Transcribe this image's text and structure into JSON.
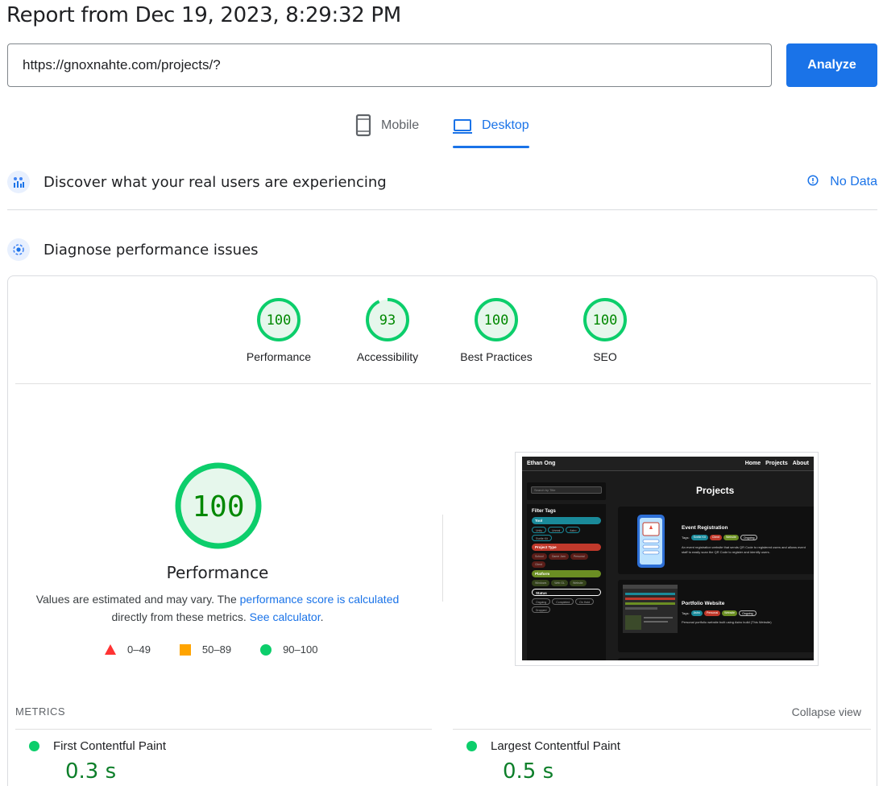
{
  "report": {
    "title": "Report from Dec 19, 2023, 8:29:32 PM"
  },
  "search": {
    "url_value": "https://gnoxnahte.com/projects/?",
    "analyze_label": "Analyze"
  },
  "tabs": [
    {
      "label": "Mobile",
      "icon": "phone-icon",
      "selected": false
    },
    {
      "label": "Desktop",
      "icon": "laptop-icon",
      "selected": true
    }
  ],
  "field_data": {
    "heading": "Discover what your real users are experiencing",
    "status": "No Data"
  },
  "diagnose": {
    "heading": "Diagnose performance issues"
  },
  "scores": [
    {
      "label": "Performance",
      "value": "100"
    },
    {
      "label": "Accessibility",
      "value": "93"
    },
    {
      "label": "Best Practices",
      "value": "100"
    },
    {
      "label": "SEO",
      "value": "100"
    }
  ],
  "performance": {
    "score": "100",
    "label": "Performance",
    "explain_1": "Values are estimated and may vary. The ",
    "explain_link_1": "performance score is calculated",
    "explain_2": "directly from these metrics. ",
    "explain_link_2": "See calculator",
    "explain_3": "."
  },
  "legend": [
    {
      "range": "0–49",
      "shape": "triangle",
      "color": "#ff3333"
    },
    {
      "range": "50–89",
      "shape": "square",
      "color": "#ffa400"
    },
    {
      "range": "90–100",
      "shape": "circle",
      "color": "#0cce6b"
    }
  ],
  "screenshot": {
    "site_name": "Ethan Ong",
    "nav": [
      "Home",
      "Projects",
      "About"
    ],
    "search_placeholder": "Search by Title",
    "page_title": "Projects",
    "filter_title": "Filter Tags",
    "groups": [
      {
        "name": "Tool",
        "color": "#1a8a9a",
        "chips": [
          "Unity",
          "Unreal",
          "Astro",
          "Svelte Kit"
        ]
      },
      {
        "name": "Project Type",
        "color": "#c0392b",
        "chips": [
          "School",
          "Game Jam",
          "Personal",
          "Client"
        ]
      },
      {
        "name": "Platform",
        "color": "#6b8e23",
        "chips": [
          "Windows",
          "Web GL",
          "Website"
        ]
      },
      {
        "name": "Status",
        "color": "#111111",
        "chips": [
          "Ongoing",
          "Completed",
          "On Hold",
          "Dropped"
        ]
      }
    ],
    "cards": [
      {
        "title": "Event Registration",
        "tags_label": "Tags:",
        "tags": [
          "Svelte Kit",
          "Client",
          "Website",
          "Ongoing"
        ],
        "desc": "An event registration website that sends QR Code to registered users and allows event staff to easily scan the QR Code to register and identify users."
      },
      {
        "title": "Portfolio Website",
        "tags_label": "Tags:",
        "tags": [
          "Astro",
          "Personal",
          "Website",
          "Ongoing"
        ],
        "desc": "Personal portfolio website built using Astro build (This Website)"
      }
    ]
  },
  "metrics": {
    "heading": "METRICS",
    "collapse_label": "Collapse view",
    "items": [
      {
        "name": "First Contentful Paint",
        "value": "0.3 s"
      },
      {
        "name": "Largest Contentful Paint",
        "value": "0.5 s"
      }
    ]
  },
  "colors": {
    "accent": "#1a73e8",
    "pass": "#0cce6b",
    "pass_text": "#008800"
  }
}
